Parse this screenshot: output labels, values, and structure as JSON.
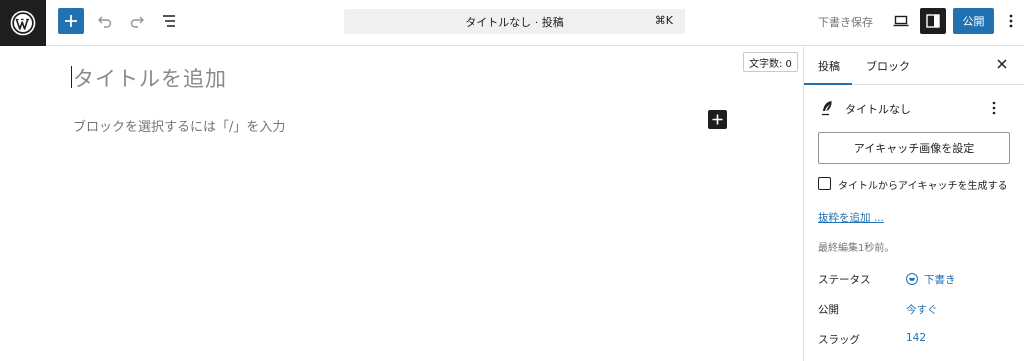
{
  "header": {
    "logo_icon": "wordpress-logo-icon",
    "command_bar": {
      "title": "タイトルなし · 投稿",
      "shortcut": "⌘K"
    },
    "save_draft_label": "下書き保存",
    "publish_label": "公開",
    "accent_color": "#2271b1"
  },
  "editor": {
    "title_placeholder": "タイトルを追加",
    "block_placeholder": "ブロックを選択するには「/」を入力",
    "word_count": "文字数: 0"
  },
  "sidebar": {
    "tabs": [
      {
        "label": "投稿",
        "active": true
      },
      {
        "label": "ブロック",
        "active": false
      }
    ],
    "post_title": "タイトルなし",
    "featured_image_button": "アイキャッチ画像を設定",
    "generate_featured_label": "タイトルからアイキャッチを生成する",
    "generate_featured_checked": false,
    "excerpt_link": "抜粋を追加 ...",
    "last_edited": "最終編集1秒前。",
    "meta": [
      {
        "label": "ステータス",
        "value": "下書き"
      },
      {
        "label": "公開",
        "value": "今すぐ"
      },
      {
        "label": "スラッグ",
        "value": "142"
      }
    ]
  }
}
